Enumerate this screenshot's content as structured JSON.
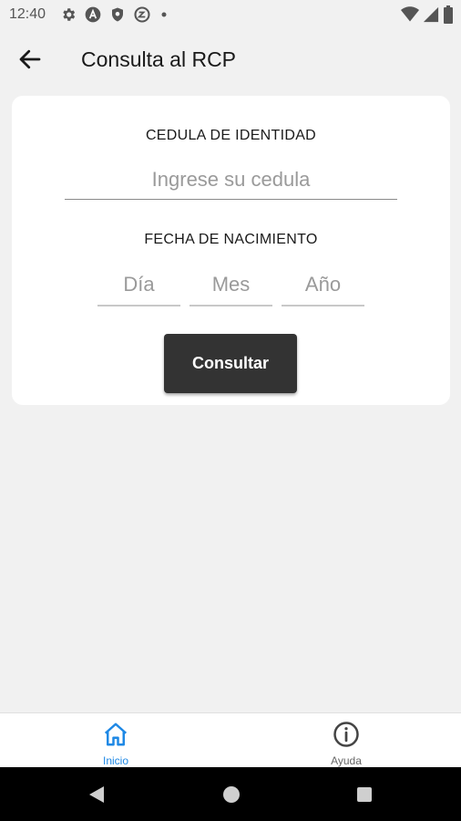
{
  "status_bar": {
    "time": "12:40",
    "left_icons": [
      "settings-icon",
      "a-badge-icon",
      "shield-icon",
      "vpn-icon",
      "dot-icon"
    ],
    "right_icons": [
      "wifi-icon",
      "signal-icon",
      "battery-icon"
    ]
  },
  "app_bar": {
    "back_icon": "arrow-left-icon",
    "title": "Consulta al RCP"
  },
  "form": {
    "cedula_label": "CEDULA DE IDENTIDAD",
    "cedula_placeholder": "Ingrese su cedula",
    "fecha_label": "FECHA DE NACIMIENTO",
    "dia_placeholder": "Día",
    "mes_placeholder": "Mes",
    "anio_placeholder": "Año",
    "submit_label": "Consultar"
  },
  "bottom_nav": {
    "items": [
      {
        "label": "Inicio",
        "icon": "home-icon",
        "active": true
      },
      {
        "label": "Ayuda",
        "icon": "info-icon",
        "active": false
      }
    ],
    "active_color": "#1e88e5"
  },
  "colors": {
    "background": "#f1f1f1",
    "card": "#ffffff",
    "button": "#333333"
  }
}
